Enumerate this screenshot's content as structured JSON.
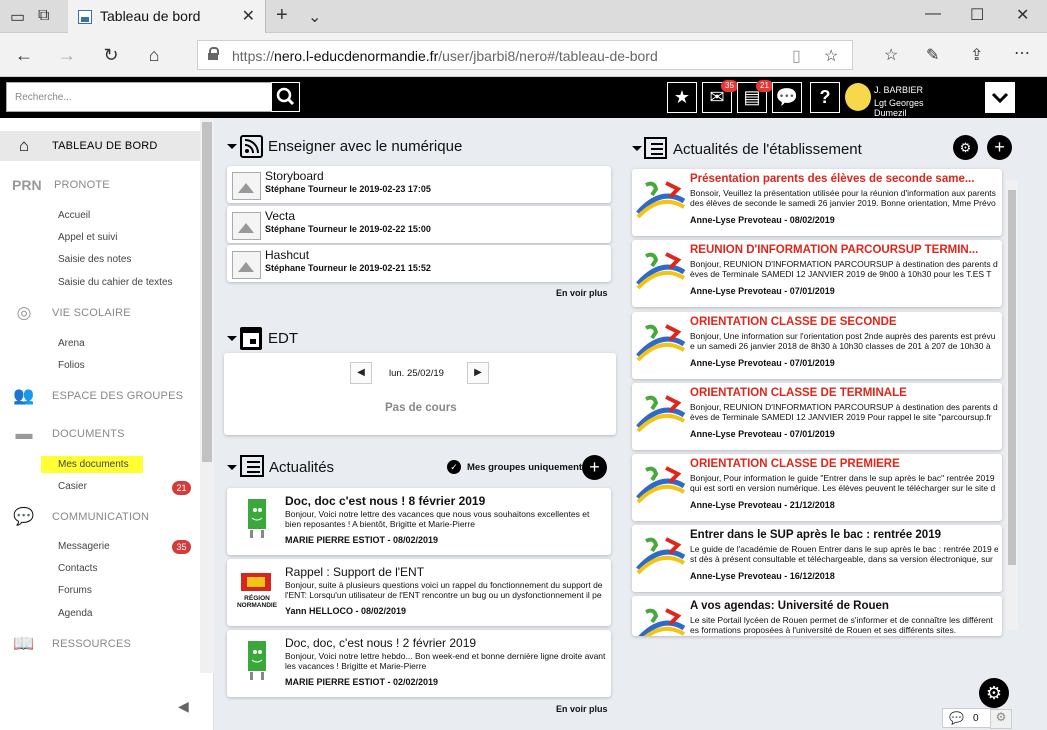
{
  "browser": {
    "tab_title": "Tableau de bord",
    "url_prefix": "https://",
    "url_host": "nero.l-educdenormandie.fr",
    "url_path": "/user/jbarbi8/nero#/tableau-de-bord"
  },
  "topbar": {
    "search_placeholder": "Recherche...",
    "messages_badge": "35",
    "casier_badge": "21",
    "user_name": "J. BARBIER",
    "user_school": "Lgt Georges Dumezil"
  },
  "sidebar": {
    "sections": [
      {
        "label": "TABLEAU DE BORD",
        "icon": "home-icon"
      },
      {
        "label": "PRONOTE",
        "icon": "prn-icon",
        "prefix": "PRN"
      },
      {
        "label": "VIE SCOLAIRE",
        "icon": "life-ring-icon"
      },
      {
        "label": "ESPACE DES GROUPES",
        "icon": "group-icon"
      },
      {
        "label": "DOCUMENTS",
        "icon": "folder-icon"
      },
      {
        "label": "COMMUNICATION",
        "icon": "chat-icon"
      },
      {
        "label": "RESSOURCES",
        "icon": "book-icon"
      }
    ],
    "pronote_items": [
      "Accueil",
      "Appel et suivi",
      "Saisie des notes",
      "Saisie du cahier de textes"
    ],
    "vie_items": [
      "Arena",
      "Folios"
    ],
    "doc_items": [
      "Mes documents",
      "Casier"
    ],
    "casier_badge": "21",
    "comm_items": [
      "Messagerie",
      "Contacts",
      "Forums",
      "Agenda"
    ],
    "messagerie_badge": "35"
  },
  "enseigner": {
    "title": "Enseigner avec le numérique",
    "items": [
      {
        "title": "Storyboard",
        "sub": "Stéphane Tourneur le 2019-02-23 17:05"
      },
      {
        "title": "Vecta",
        "sub": "Stéphane Tourneur le 2019-02-22 15:00"
      },
      {
        "title": "Hashcut",
        "sub": "Stéphane Tourneur le 2019-02-21 15:52"
      }
    ],
    "more": "En voir plus"
  },
  "edt": {
    "title": "EDT",
    "date": "lun. 25/02/19",
    "empty": "Pas de cours"
  },
  "actualites": {
    "title": "Actualités",
    "filter": "Mes groupes uniquement",
    "items": [
      {
        "title": "Doc, doc c'est nous ! 8 février 2019",
        "body": "Bonjour, Voici notre lettre des vacances que nous vous souhaitons excellentes et bien reposantes ! A bientôt, Brigitte et Marie-Pierre",
        "author": "MARIE PIERRE ESTIOT - 08/02/2019",
        "img": "book-mascot"
      },
      {
        "title": "Rappel : Support de l'ENT",
        "body": "Bonjour, suite à plusieurs questions voici un rappel du fonctionnement du support de l'ENT: Lorsqu'un utilisateur de l'ENT rencontre un bug ou un dysfonctionnement il pe",
        "author": "Yann HELLOCO - 08/02/2019",
        "img": "normandie-logo",
        "logo_text": "RÉGION NORMANDIE"
      },
      {
        "title": "Doc, doc, c'est nous ! 2 février 2019",
        "body": "Bonjour, Voici notre lettre hebdo... Bon week-end et bonne dernière ligne droite avant les vacances ! Brigitte et Marie-Pierre",
        "author": "MARIE PIERRE ESTIOT - 02/02/2019",
        "img": "book-mascot"
      }
    ],
    "more": "En voir plus"
  },
  "etab": {
    "title": "Actualités de l'établissement",
    "items": [
      {
        "title": "Présentation parents des élèves de seconde same...",
        "body1": "Bonsoir, Veuillez la présentation utilisée pour la réunion d'information aux parents",
        "body2": "des élèves de seconde le samedi 26 janvier 2019. Bonne orientation, Mme Prévo",
        "author": "Anne-Lyse Prevoteau - 08/02/2019",
        "red": true
      },
      {
        "title": "REUNION D'INFORMATION PARCOURSUP TERMIN...",
        "body1": "Bonjour, REUNION D'INFORMATION PARCOURSUP à destination des parents d'él",
        "body2": "èves de Terminale SAMEDI 12 JANVIER 2019 de 9h00 à 10h30 pour les T.ES T",
        "author": "Anne-Lyse Prevoteau - 07/01/2019",
        "red": true
      },
      {
        "title": "ORIENTATION CLASSE DE SECONDE",
        "body1": "Bonjour, Une information sur l'orientation post 2nde auprès des parents est prévu",
        "body2": "e un samedi 26 janvier 2018 de 8h30 à 10h30 classes de 201 à 207 de 10h30 à",
        "author": "Anne-Lyse Prevoteau - 07/01/2019",
        "red": true
      },
      {
        "title": "ORIENTATION CLASSE DE TERMINALE",
        "body1": "Bonjour, REUNION D'INFORMATION PARCOURSUP à destination des parents d'él",
        "body2": "èves de Terminale SAMEDI 12 JANVIER 2019 Pour rappel le site \"parcoursup.fr",
        "author": "Anne-Lyse Prevoteau - 07/01/2019",
        "red": true
      },
      {
        "title": "ORIENTATION CLASSE DE PREMIERE",
        "body1": "Bonjour, Pour information le guide \"Entrer dans le sup après le bac\" rentrée 2019",
        "body2": "qui est sorti en version numérique. Les élèves peuvent le télécharger sur le site d",
        "author": "Anne-Lyse Prevoteau - 21/12/2018",
        "red": true
      },
      {
        "title": "Entrer dans le SUP après le bac : rentrée 2019",
        "body1": "Le guide de l'académie de Rouen Entrer dans le sup après le bac : rentrée 2019 e",
        "body2": "st dès à présent consultable et téléchargeable, dans sa version électronique, sur",
        "author": "Anne-Lyse Prevoteau - 16/12/2018",
        "red": false
      },
      {
        "title": "A vos agendas: Université de Rouen",
        "body1": "Le site Portail lycéen de Rouen permet de s'informer et de connaître les différent",
        "body2": "es formations proposées à l'université de Rouen et ses différents sites.",
        "author": "",
        "red": false
      }
    ]
  },
  "chat": {
    "count": "0"
  },
  "colors": {
    "accent_red": "#e0261b",
    "badge_red": "#d63b3b",
    "highlight": "#ffff33"
  }
}
